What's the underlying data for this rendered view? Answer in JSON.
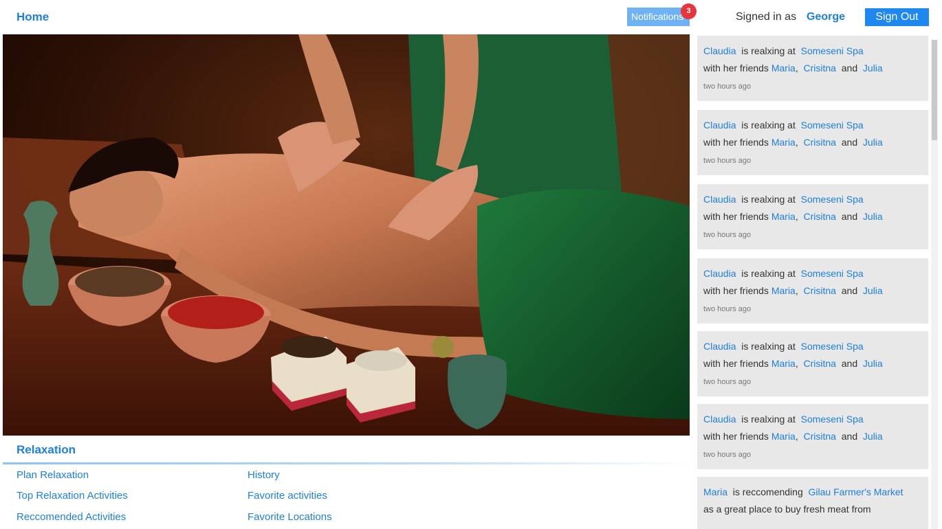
{
  "header": {
    "home": "Home",
    "notifications": "Notifications",
    "notification_count": "3",
    "signed_in_as": "Signed in as",
    "user": "George",
    "sign_out": "Sign Out"
  },
  "section": {
    "title": "Relaxation",
    "links_col1": [
      "Plan Relaxation",
      "Top Relaxation Activities",
      "Reccomended Activities"
    ],
    "links_col2": [
      "History",
      "Favorite activities",
      "Favorite Locations"
    ]
  },
  "feed": {
    "items": [
      {
        "person": "Claudia",
        "verb": "is realxing at",
        "place": "Someseni Spa",
        "with": "with her friends",
        "friend1": "Maria",
        "sep": ",",
        "friend2": "Crisitna",
        "and": "and",
        "friend3": "Julia",
        "time": "two hours ago"
      },
      {
        "person": "Claudia",
        "verb": "is realxing at",
        "place": "Someseni Spa",
        "with": "with her friends",
        "friend1": "Maria",
        "sep": ",",
        "friend2": "Crisitna",
        "and": "and",
        "friend3": "Julia",
        "time": "two hours ago"
      },
      {
        "person": "Claudia",
        "verb": "is realxing at",
        "place": "Someseni Spa",
        "with": "with her friends",
        "friend1": "Maria",
        "sep": ",",
        "friend2": "Crisitna",
        "and": "and",
        "friend3": "Julia",
        "time": "two hours ago"
      },
      {
        "person": "Claudia",
        "verb": "is realxing at",
        "place": "Someseni Spa",
        "with": "with her friends",
        "friend1": "Maria",
        "sep": ",",
        "friend2": "Crisitna",
        "and": "and",
        "friend3": "Julia",
        "time": "two hours ago"
      },
      {
        "person": "Claudia",
        "verb": "is realxing at",
        "place": "Someseni Spa",
        "with": "with her friends",
        "friend1": "Maria",
        "sep": ",",
        "friend2": "Crisitna",
        "and": "and",
        "friend3": "Julia",
        "time": "two hours ago"
      },
      {
        "person": "Claudia",
        "verb": "is realxing at",
        "place": "Someseni Spa",
        "with": "with her friends",
        "friend1": "Maria",
        "sep": ",",
        "friend2": "Crisitna",
        "and": "and",
        "friend3": "Julia",
        "time": "two hours ago"
      }
    ],
    "last": {
      "person": "Maria",
      "verb": "is reccomending",
      "place": "Gilau Farmer's Market",
      "line2": "as a great place to buy fresh meat from"
    }
  },
  "colors": {
    "accent": "#1e7fe0",
    "badge": "#e8343c",
    "feed_bg": "#e8e8e8"
  },
  "icons": {
    "hero": "spa-massage-photo"
  }
}
